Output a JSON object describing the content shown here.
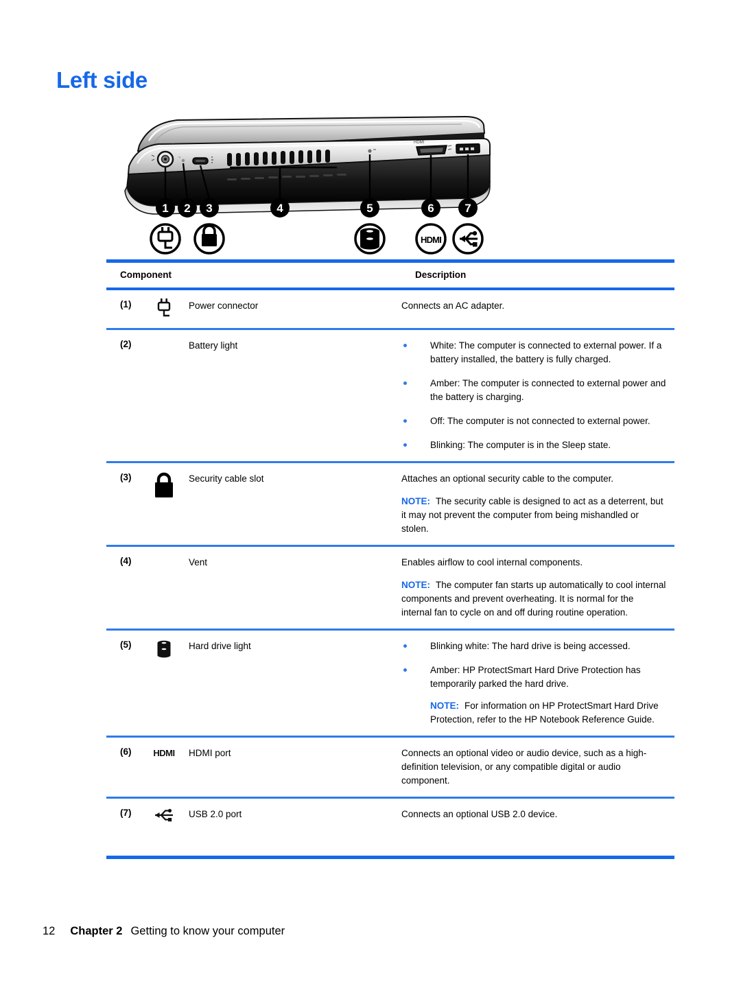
{
  "document": {
    "title": "Left side"
  },
  "illustration": {
    "alt_name": "laptop-left-side-diagram",
    "callouts": [
      "1",
      "2",
      "3",
      "4",
      "5",
      "6",
      "7"
    ],
    "callout_icons": [
      {
        "number": "1",
        "icon": "power-connector-icon"
      },
      {
        "number": "3",
        "icon": "lock-icon"
      },
      {
        "number": "5",
        "icon": "hard-drive-icon"
      },
      {
        "number": "6",
        "icon": "hdmi-icon"
      },
      {
        "number": "7",
        "icon": "usb-icon"
      }
    ]
  },
  "table": {
    "headers": {
      "component": "Component",
      "description": "Description"
    },
    "rows": [
      {
        "num": "(1)",
        "icon": "power-connector-icon",
        "name": "Power connector",
        "desc_paragraphs": [
          "Connects an AC adapter."
        ],
        "bullets": [],
        "notes": []
      },
      {
        "num": "(2)",
        "icon": "none",
        "name": "Battery light",
        "desc_paragraphs": [],
        "bullets": [
          "White: The computer is connected to external power. If a battery installed, the battery is fully charged.",
          "Amber: The computer is connected to external power and the battery is charging.",
          "Off: The computer is not connected to external power.",
          "Blinking: The computer is in the Sleep state."
        ],
        "notes": []
      },
      {
        "num": "(3)",
        "icon": "lock-icon",
        "name": "Security cable slot",
        "desc_paragraphs": [
          "Attaches an optional security cable to the computer."
        ],
        "bullets": [],
        "notes": [
          {
            "label": "NOTE:",
            "text": "The security cable is designed to act as a deterrent, but it may not prevent the computer from being mishandled or stolen."
          }
        ]
      },
      {
        "num": "(4)",
        "icon": "none",
        "name": "Vent",
        "desc_paragraphs": [
          "Enables airflow to cool internal components."
        ],
        "bullets": [],
        "notes": [
          {
            "label": "NOTE:",
            "text": "The computer fan starts up automatically to cool internal components and prevent overheating. It is normal for the internal fan to cycle on and off during routine operation."
          }
        ]
      },
      {
        "num": "(5)",
        "icon": "hard-drive-icon",
        "name": "Hard drive light",
        "desc_paragraphs": [],
        "bullets": [
          "Blinking white: The hard drive is being accessed.",
          "Amber: HP ProtectSmart Hard Drive Protection has temporarily parked the hard drive."
        ],
        "notes": [
          {
            "label": "NOTE:",
            "text": "For information on HP ProtectSmart Hard Drive Protection, refer to the HP Notebook Reference Guide."
          }
        ]
      },
      {
        "num": "(6)",
        "icon": "hdmi-icon",
        "name": "HDMI port",
        "desc_paragraphs": [
          "Connects an optional video or audio device, such as a high-definition television, or any compatible digital or audio component."
        ],
        "bullets": [],
        "notes": []
      },
      {
        "num": "(7)",
        "icon": "usb-icon",
        "name": "USB 2.0 port",
        "desc_paragraphs": [
          "Connects an optional USB 2.0 device."
        ],
        "bullets": [],
        "notes": []
      }
    ]
  },
  "footer": {
    "page_number": "12",
    "chapter": "Chapter 2",
    "chapter_title": "Getting to know your computer"
  },
  "colors": {
    "accent_blue": "#1668E8",
    "bullet_blue": "#2E7BEA"
  }
}
